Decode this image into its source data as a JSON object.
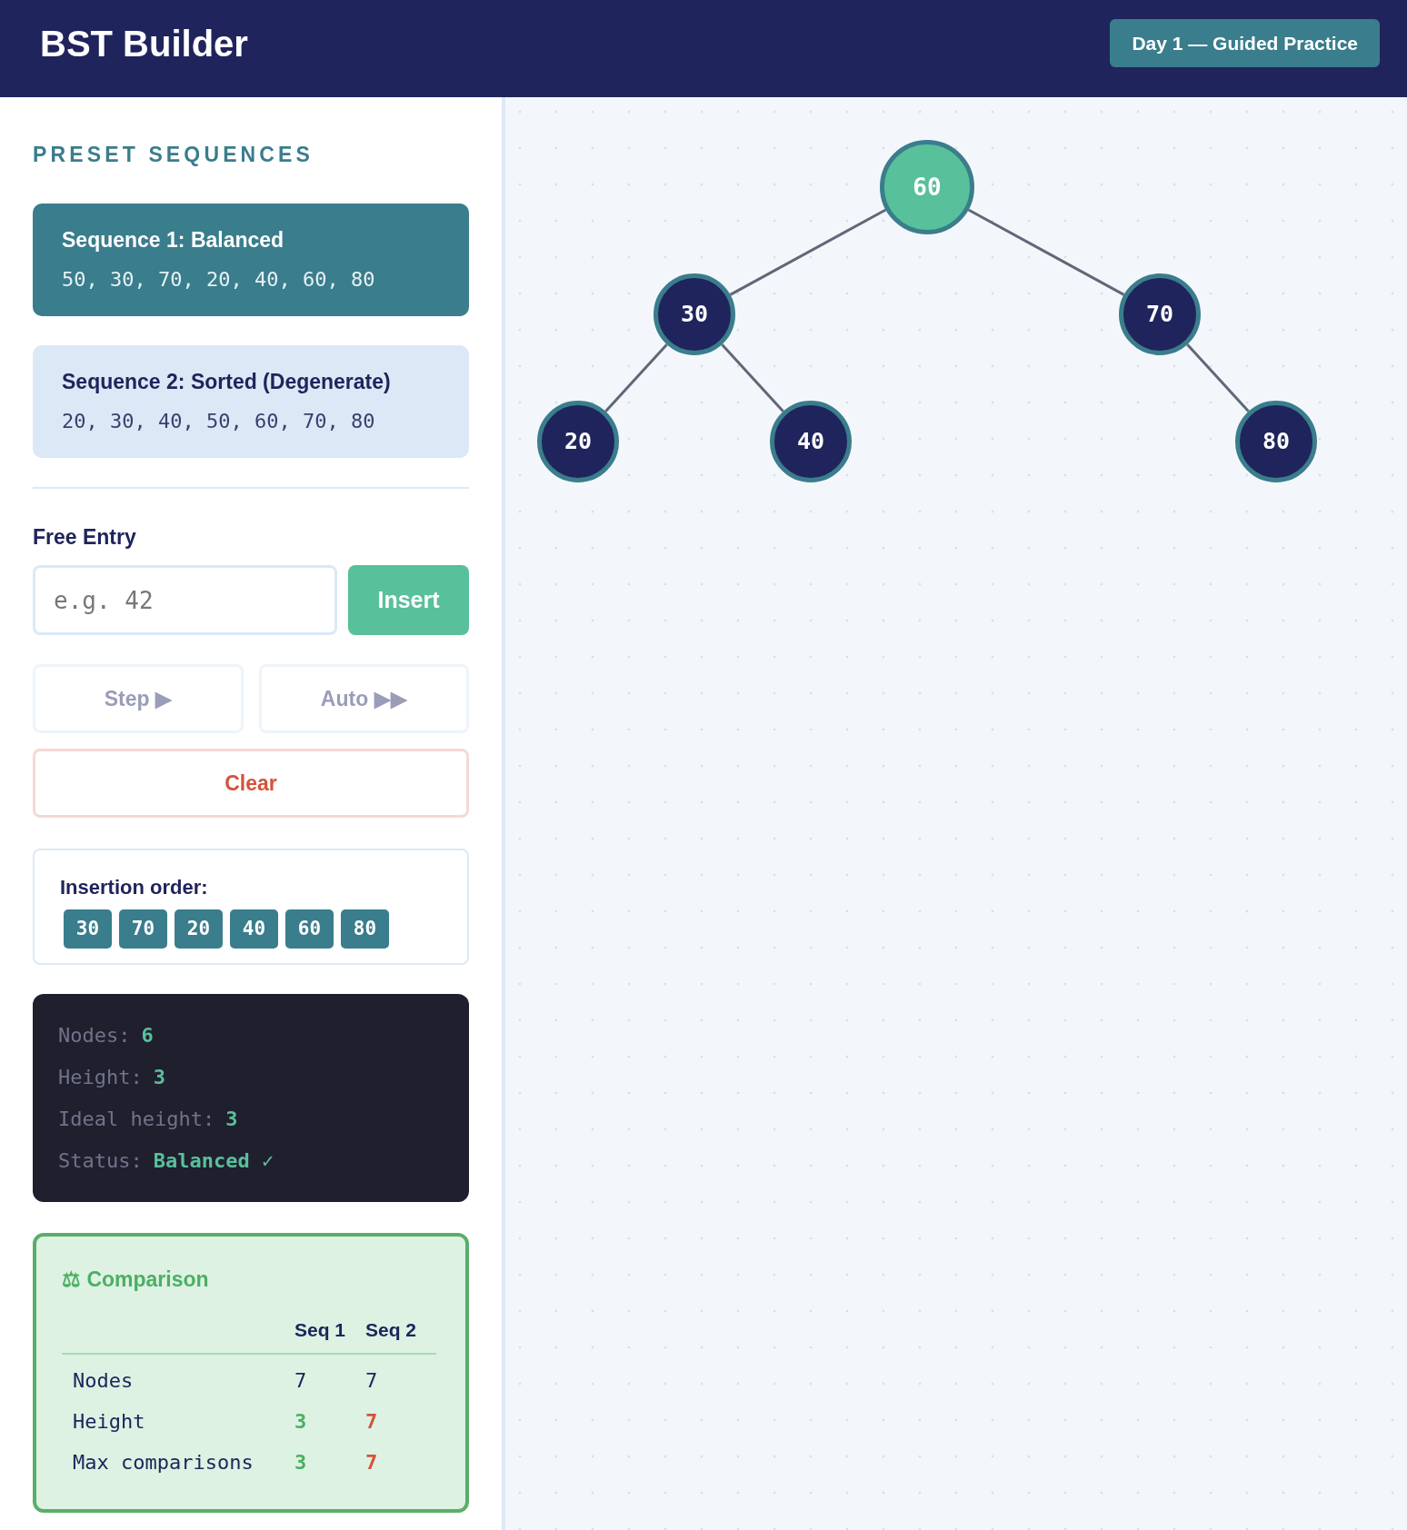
{
  "header": {
    "title": "BST Builder",
    "badge": "Day 1 — Guided Practice"
  },
  "sidebar": {
    "section_title": "PRESET SEQUENCES",
    "sequences": [
      {
        "title": "Sequence 1: Balanced",
        "values": "50, 30, 70, 20, 40, 60, 80",
        "selected": true
      },
      {
        "title": "Sequence 2: Sorted (Degenerate)",
        "values": "20, 30, 40, 50, 60, 70, 80",
        "selected": false
      }
    ],
    "free_entry": {
      "label": "Free Entry",
      "placeholder": "e.g. 42",
      "insert_button": "Insert"
    },
    "controls": [
      {
        "label": "Step ▶",
        "disabled": true
      },
      {
        "label": "Auto ▶▶",
        "disabled": true
      }
    ],
    "clear_button": "Clear",
    "insertion_order": {
      "label": "Insertion order:",
      "items": [
        "30",
        "70",
        "20",
        "40",
        "60",
        "80"
      ]
    },
    "stats": [
      {
        "label": "Nodes:",
        "value": "6"
      },
      {
        "label": "Height:",
        "value": "3"
      },
      {
        "label": "Ideal height:",
        "value": "3"
      },
      {
        "label": "Status:",
        "value": "Balanced ✓"
      }
    ],
    "comparison": {
      "title": "⚖ Comparison",
      "columns": [
        "Seq 1",
        "Seq 2"
      ],
      "rows": [
        {
          "label": "Nodes",
          "cells": [
            {
              "text": "7",
              "kind": "plain"
            },
            {
              "text": "7",
              "kind": "plain"
            }
          ]
        },
        {
          "label": "Height",
          "cells": [
            {
              "text": "3",
              "kind": "good"
            },
            {
              "text": "7",
              "kind": "bad"
            }
          ]
        },
        {
          "label": "Max comparisons",
          "cells": [
            {
              "text": "3",
              "kind": "good"
            },
            {
              "text": "7",
              "kind": "bad"
            }
          ]
        }
      ]
    }
  },
  "tree": {
    "value": "60",
    "highlighted": true,
    "left": {
      "value": "30",
      "highlighted": false,
      "left": {
        "value": "20",
        "highlighted": false
      },
      "right": {
        "value": "40",
        "highlighted": false
      }
    },
    "right": {
      "value": "70",
      "highlighted": false,
      "right": {
        "value": "80",
        "highlighted": false
      }
    }
  }
}
